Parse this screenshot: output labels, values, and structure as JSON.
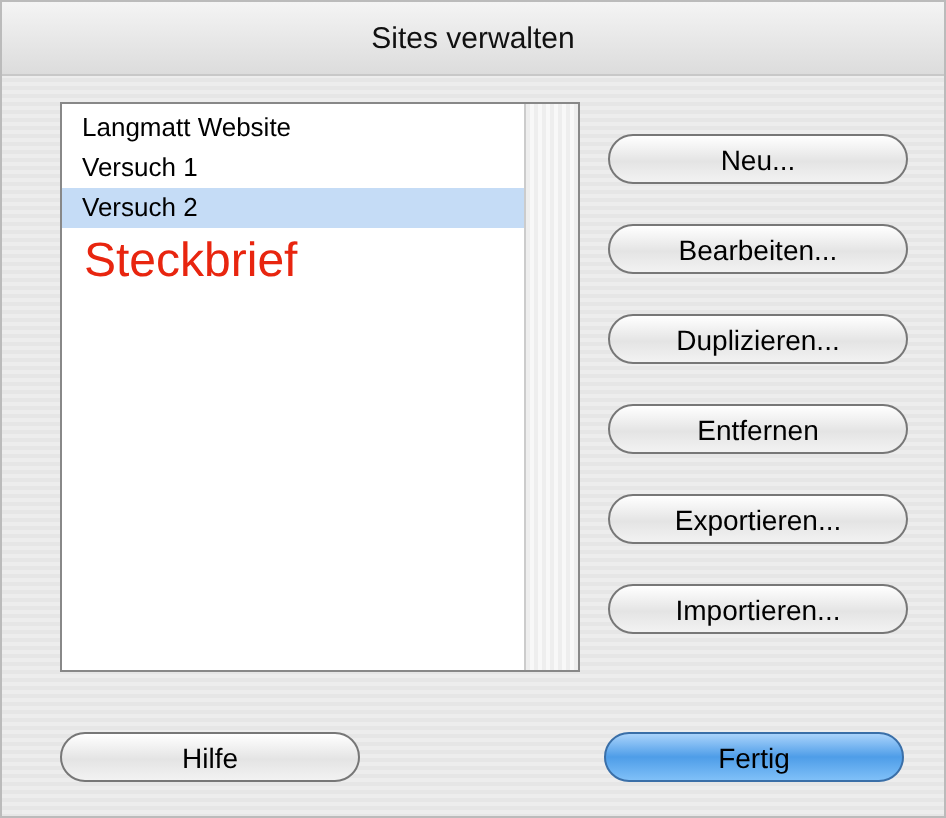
{
  "window": {
    "title": "Sites verwalten"
  },
  "sites": [
    {
      "label": "Langmatt Website",
      "selected": false
    },
    {
      "label": "Versuch 1",
      "selected": false
    },
    {
      "label": "Versuch 2",
      "selected": true
    }
  ],
  "annotation": "Steckbrief",
  "buttons": [
    "Neu...",
    "Bearbeiten...",
    "Duplizieren...",
    "Entfernen",
    "Exportieren...",
    "Importieren..."
  ],
  "footer_buttons": [
    {
      "label": "Hilfe",
      "default": false
    },
    {
      "label": "Fertig",
      "default": true
    }
  ]
}
